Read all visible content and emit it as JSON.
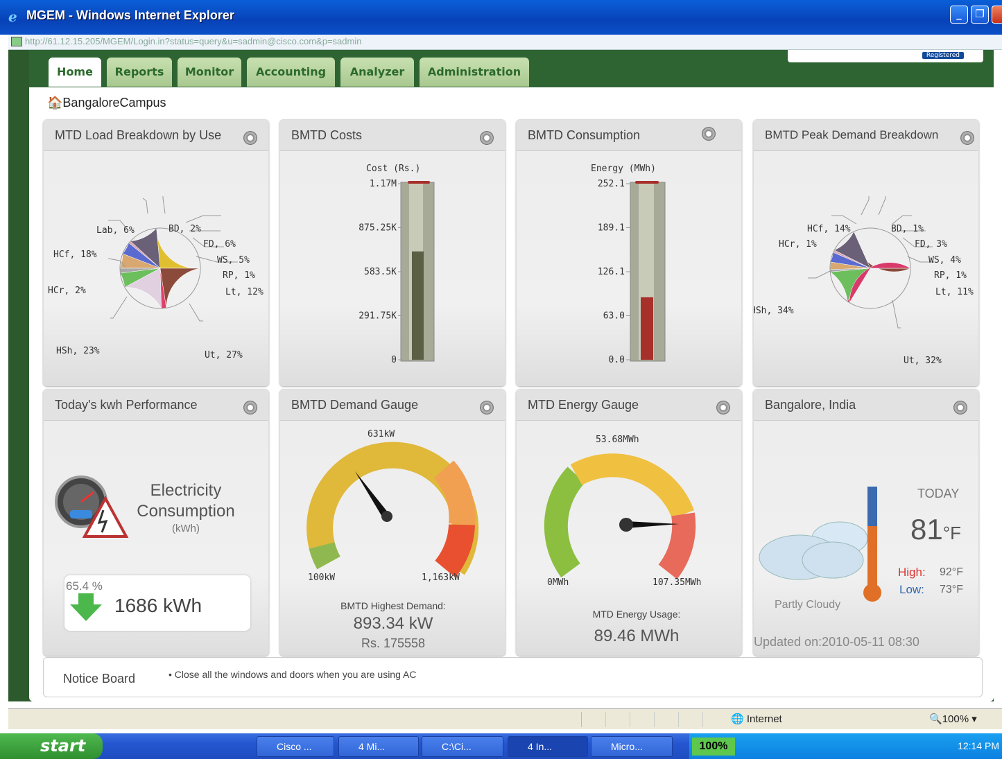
{
  "window": {
    "title": "MGEM - Windows Internet Explorer"
  },
  "address": {
    "host": "http://61.12.15.205",
    "path": "/MGEM/Login.in?status=query&u=sadmin@cisco.com&p=sadmin"
  },
  "nav": {
    "tabs": [
      "Home",
      "Reports",
      "Monitor",
      "Accounting",
      "Analyzer",
      "Administration"
    ],
    "active": "Home",
    "badge": "Registered"
  },
  "breadcrumb": "BangaloreCampus",
  "panels": {
    "load": {
      "title": "MTD Load Breakdown by Use",
      "labels": [
        "Lab, 6%",
        "BD, 2%",
        "FD, 6%",
        "HCf, 18%",
        "WS, 5%",
        "RP, 1%",
        "HCr, 2%",
        "Lt, 12%",
        "HSh, 23%",
        "Ut, 27%"
      ]
    },
    "costs": {
      "title": "BMTD Costs",
      "axis_title": "Cost (Rs.)",
      "ticks": [
        "1.17M",
        "875.25K",
        "583.5K",
        "291.75K",
        "0"
      ]
    },
    "consumption": {
      "title": "BMTD Consumption",
      "axis_title": "Energy (MWh)",
      "ticks": [
        "252.1",
        "189.1",
        "126.1",
        "63.0",
        "0.0"
      ]
    },
    "peak": {
      "title": "BMTD Peak Demand Breakdown",
      "labels": [
        "HCf, 14%",
        "BD, 1%",
        "HCr, 1%",
        "FD, 3%",
        "WS, 4%",
        "RP, 1%",
        "Lt, 11%",
        "HSh, 34%",
        "Ut, 32%"
      ]
    },
    "kwh": {
      "title": "Today's kwh Performance",
      "heading1": "Electricity",
      "heading2": "Consumption",
      "unit": "(kWh)",
      "percent": "65.4 %",
      "value": "1686 kWh"
    },
    "demand": {
      "title": "BMTD Demand Gauge",
      "top": "631kW",
      "min": "100kW",
      "max": "1,163kW",
      "caption": "BMTD Highest Demand:",
      "value": "893.34 kW",
      "cost": "Rs. 175558"
    },
    "energy": {
      "title": "MTD Energy Gauge",
      "top": "53.68MWh",
      "min": "0MWh",
      "max": "107.35MWh",
      "caption": "MTD Energy Usage:",
      "value": "89.46 MWh"
    },
    "weather": {
      "title": "Bangalore, India",
      "today": "TODAY",
      "temp": "81",
      "unit": "°F",
      "high_label": "High:",
      "high": "92°F",
      "low_label": "Low:",
      "low": "73°F",
      "condition": "Partly Cloudy",
      "updated": "Updated on:2010-05-11 08:30"
    }
  },
  "notice": {
    "title": "Notice Board",
    "item": "• Close all the windows and doors when you are using AC"
  },
  "status": {
    "zone": "Internet",
    "zoom": "100%"
  },
  "taskbar": {
    "start": "start",
    "items": [
      "Cisco ...",
      "4 Mi...",
      "C:\\Ci...",
      "4 In...",
      "Micro..."
    ],
    "battery": "100%",
    "clock": "12:14 PM"
  },
  "chart_data": [
    {
      "type": "pie",
      "title": "MTD Load Breakdown by Use",
      "categories": [
        "Ut",
        "Lt",
        "RP",
        "WS",
        "FD",
        "BD",
        "Lab",
        "HCf",
        "HCr",
        "HSh"
      ],
      "values": [
        27,
        12,
        1,
        5,
        6,
        2,
        6,
        18,
        2,
        23
      ],
      "colors": [
        "#e0c030",
        "#6a6078",
        "#d8a8b8",
        "#5a6ad0",
        "#d8a870",
        "#a8a8a8",
        "#6cbf5c",
        "#e0d0e0",
        "#e0406a",
        "#8b4a3a"
      ]
    },
    {
      "type": "bar",
      "title": "BMTD Costs",
      "ylabel": "Cost (Rs.)",
      "ylim": [
        0,
        1170000
      ],
      "values": [
        720000
      ],
      "color": "#5b6045"
    },
    {
      "type": "bar",
      "title": "BMTD Consumption",
      "ylabel": "Energy (MWh)",
      "ylim": [
        0,
        252.1
      ],
      "values": [
        89.46
      ],
      "color": "#a8302a"
    },
    {
      "type": "pie",
      "title": "BMTD Peak Demand Breakdown",
      "categories": [
        "Ut",
        "Lt",
        "RP",
        "WS",
        "FD",
        "BD",
        "HCf",
        "HCr",
        "HSh"
      ],
      "values": [
        32,
        11,
        1,
        4,
        3,
        1,
        14,
        1,
        34
      ],
      "colors": [
        "#8b4a3a",
        "#6a6078",
        "#d8a8b8",
        "#5a6ad0",
        "#d8a870",
        "#a8a8a8",
        "#6cbf5c",
        "#e0406a",
        "#d83a6a"
      ]
    }
  ]
}
